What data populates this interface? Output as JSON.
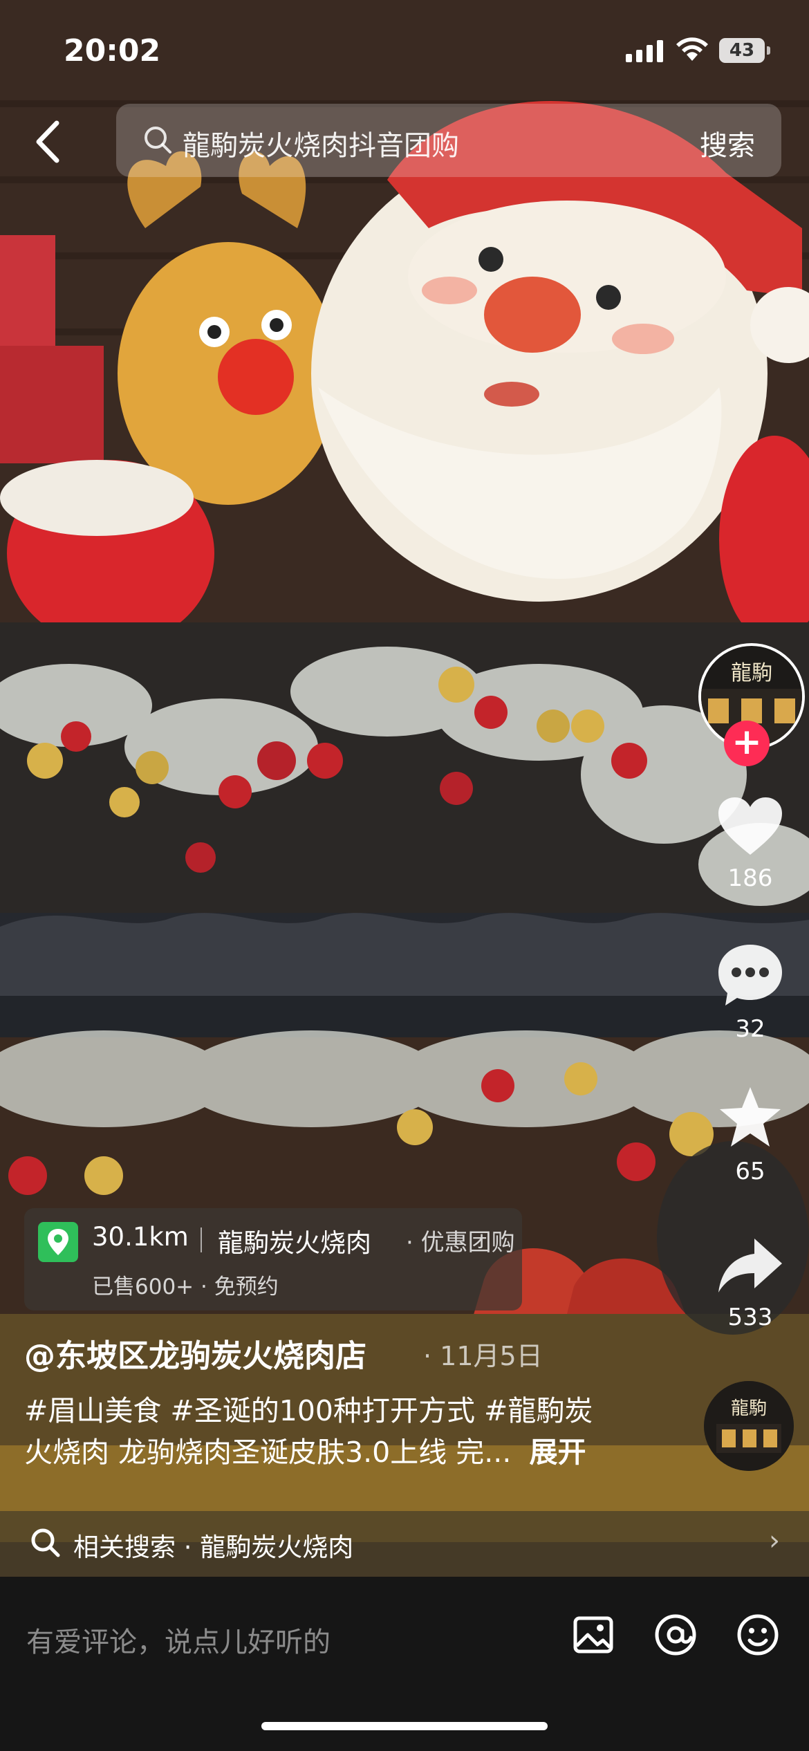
{
  "status_bar": {
    "time": "20:02",
    "battery": "43"
  },
  "search": {
    "query": "龍駒炭火烧肉抖音团购",
    "button_label": "搜索"
  },
  "actions": {
    "like_count": "186",
    "comment_count": "32",
    "favorite_count": "65",
    "share_count": "533"
  },
  "avatar": {
    "label": "龍駒"
  },
  "poi": {
    "distance": "30.1km",
    "name": "龍駒炭火烧肉",
    "tag": "· 优惠团购",
    "sub": "已售600+ · 免预约"
  },
  "post": {
    "author": "@东坡区龙驹炭火烧肉店",
    "date": "· 11月5日",
    "caption_line1": "#眉山美食 #圣诞的100种打开方式 #龍駒炭",
    "caption_line2": "火烧肉 龙驹烧肉圣诞皮肤3.0上线 完...",
    "expand_label": "展开"
  },
  "related_search": {
    "label": "相关搜索 · 龍駒炭火烧肉"
  },
  "comment_bar": {
    "placeholder": "有爱评论，说点儿好听的"
  },
  "colors": {
    "accent": "#fe2c55",
    "poi_green": "#2fbf5a"
  }
}
